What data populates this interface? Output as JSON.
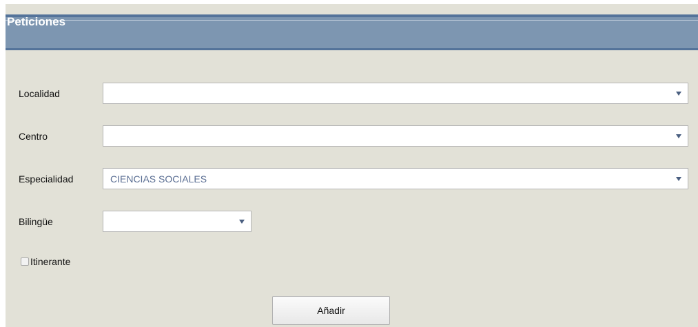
{
  "panel": {
    "title": "Peticiones"
  },
  "form": {
    "localidad": {
      "label": "Localidad",
      "value": ""
    },
    "centro": {
      "label": "Centro",
      "value": ""
    },
    "especialidad": {
      "label": "Especialidad",
      "value": "CIENCIAS SOCIALES"
    },
    "bilingue": {
      "label": "Bilingüe",
      "value": ""
    },
    "itinerante": {
      "label": "Itinerante",
      "checked": false
    },
    "add_label": "Añadir"
  },
  "icons": {
    "dropdown": "chevron-down-icon"
  },
  "colors": {
    "header_bg": "#7d96b1",
    "panel_bg": "#e2e1d7",
    "select_text": "#5a6e93"
  }
}
